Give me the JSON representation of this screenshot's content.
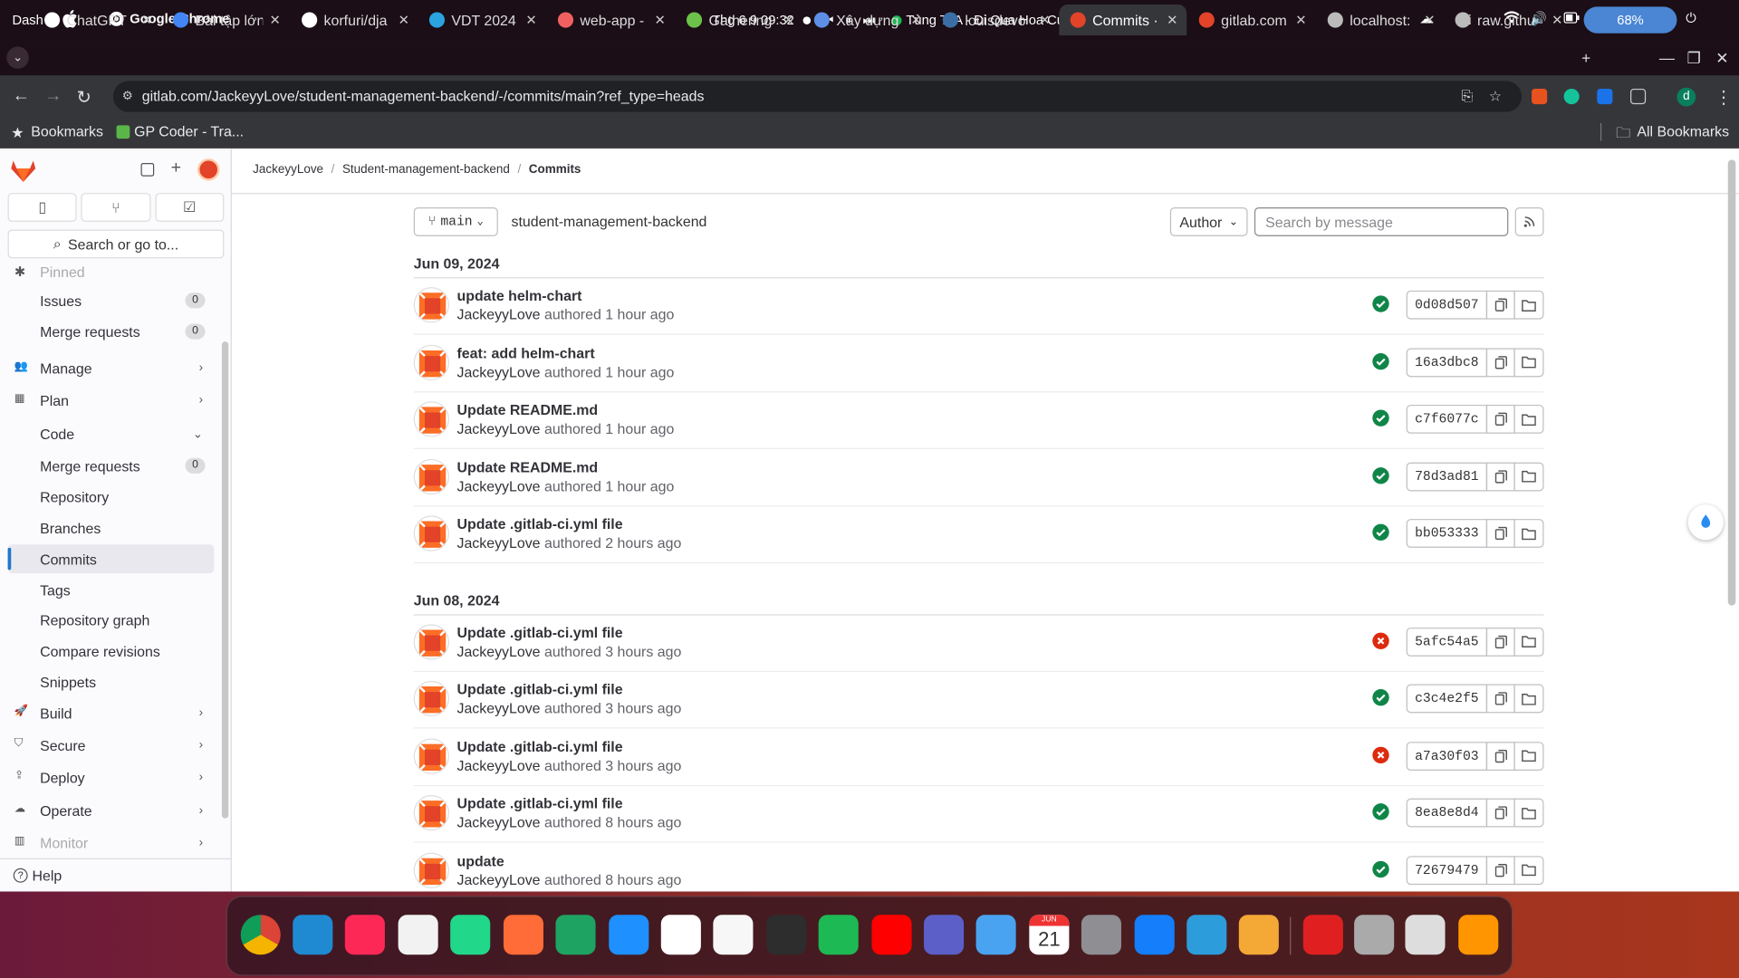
{
  "os": {
    "dash": "Dash",
    "app": "Google Chrome",
    "clock": "Thg 6 9  09:32",
    "song": "Tùng TeA - Đi Qua Hoa Cúc",
    "lang": "vi",
    "battery": "68%"
  },
  "tabs": [
    {
      "label": "ChatGPT",
      "color": "#ffffff"
    },
    {
      "label": "Bài tập lớn",
      "color": "#4285f4"
    },
    {
      "label": "korfuri/dja",
      "color": "#ffffff"
    },
    {
      "label": "VDT 2024",
      "color": "#2aa3e0"
    },
    {
      "label": "web-app -",
      "color": "#f06060"
    },
    {
      "label": "Gathering",
      "color": "#6cc24a"
    },
    {
      "label": "Xây dựng",
      "color": "#5e8ee6"
    },
    {
      "label": "louisdevo",
      "color": "#3a6ea5"
    },
    {
      "label": "Commits ·",
      "color": "#e24329"
    },
    {
      "label": "gitlab.com",
      "color": "#e24329"
    },
    {
      "label": "localhost:",
      "color": "#bbbbbb"
    },
    {
      "label": "raw.githu",
      "color": "#bbbbbb"
    }
  ],
  "browser": {
    "url": "gitlab.com/JackeyyLove/student-management-backend/-/commits/main?ref_type=heads",
    "bookmarks": "Bookmarks",
    "bookmark1": "GP Coder - Tra...",
    "all_bookmarks": "All Bookmarks",
    "profile": "d"
  },
  "sidebar": {
    "search": "Search or go to...",
    "pinned": "Pinned",
    "help": "Help",
    "items": [
      {
        "label": "Issues",
        "count": "0",
        "type": "sub"
      },
      {
        "label": "Merge requests",
        "count": "0",
        "type": "sub"
      },
      {
        "label": "Manage",
        "type": "top",
        "icon": "users-icon"
      },
      {
        "label": "Plan",
        "type": "top",
        "icon": "plan-icon"
      },
      {
        "label": "Code",
        "type": "top-open",
        "icon": "code-icon"
      },
      {
        "label": "Merge requests",
        "count": "0",
        "type": "sub"
      },
      {
        "label": "Repository",
        "type": "sub"
      },
      {
        "label": "Branches",
        "type": "sub"
      },
      {
        "label": "Commits",
        "type": "sub",
        "selected": true
      },
      {
        "label": "Tags",
        "type": "sub"
      },
      {
        "label": "Repository graph",
        "type": "sub"
      },
      {
        "label": "Compare revisions",
        "type": "sub"
      },
      {
        "label": "Snippets",
        "type": "sub"
      },
      {
        "label": "Build",
        "type": "top",
        "icon": "rocket-icon"
      },
      {
        "label": "Secure",
        "type": "top",
        "icon": "shield-icon"
      },
      {
        "label": "Deploy",
        "type": "top",
        "icon": "deploy-icon"
      },
      {
        "label": "Operate",
        "type": "top",
        "icon": "cloud-icon"
      },
      {
        "label": "Monitor",
        "type": "top",
        "icon": "monitor-icon"
      }
    ]
  },
  "breadcrumb": [
    "JackeyyLove",
    "Student-management-backend",
    "Commits"
  ],
  "toolbar": {
    "branch": "main",
    "project": "student-management-backend",
    "author": "Author",
    "search_placeholder": "Search by message"
  },
  "days": [
    {
      "date": "Jun 09, 2024",
      "commits": [
        {
          "title": "update helm-chart",
          "author": "JackeyyLove",
          "time": "authored 1 hour ago",
          "status": "success",
          "sha": "0d08d507"
        },
        {
          "title": "feat: add helm-chart",
          "author": "JackeyyLove",
          "time": "authored 1 hour ago",
          "status": "success",
          "sha": "16a3dbc8"
        },
        {
          "title": "Update README.md",
          "author": "JackeyyLove",
          "time": "authored 1 hour ago",
          "status": "success",
          "sha": "c7f6077c"
        },
        {
          "title": "Update README.md",
          "author": "JackeyyLove",
          "time": "authored 1 hour ago",
          "status": "success",
          "sha": "78d3ad81"
        },
        {
          "title": "Update .gitlab-ci.yml file",
          "author": "JackeyyLove",
          "time": "authored 2 hours ago",
          "status": "success",
          "sha": "bb053333"
        }
      ]
    },
    {
      "date": "Jun 08, 2024",
      "commits": [
        {
          "title": "Update .gitlab-ci.yml file",
          "author": "JackeyyLove",
          "time": "authored 3 hours ago",
          "status": "failed",
          "sha": "5afc54a5"
        },
        {
          "title": "Update .gitlab-ci.yml file",
          "author": "JackeyyLove",
          "time": "authored 3 hours ago",
          "status": "success",
          "sha": "c3c4e2f5"
        },
        {
          "title": "Update .gitlab-ci.yml file",
          "author": "JackeyyLove",
          "time": "authored 3 hours ago",
          "status": "failed",
          "sha": "a7a30f03"
        },
        {
          "title": "Update .gitlab-ci.yml file",
          "author": "JackeyyLove",
          "time": "authored 8 hours ago",
          "status": "success",
          "sha": "8ea8e8d4"
        },
        {
          "title": "update",
          "author": "JackeyyLove",
          "time": "authored 8 hours ago",
          "status": "success",
          "sha": "72679479"
        }
      ]
    }
  ],
  "dock": [
    {
      "name": "chrome-icon",
      "color": "#4285f4"
    },
    {
      "name": "vscode-icon",
      "color": "#1f8ad2"
    },
    {
      "name": "intellij-icon",
      "color": "#fe2857"
    },
    {
      "name": "apps-grid-icon",
      "color": "#f2f2f2"
    },
    {
      "name": "pycharm-icon",
      "color": "#21d789"
    },
    {
      "name": "postman-icon",
      "color": "#ff6c37"
    },
    {
      "name": "sheets-icon",
      "color": "#1ea362"
    },
    {
      "name": "app-store-icon",
      "color": "#1e90ff"
    },
    {
      "name": "notion-icon",
      "color": "#ffffff"
    },
    {
      "name": "notes-icon",
      "color": "#f7f7f7"
    },
    {
      "name": "terminal-icon",
      "color": "#2d2d2d"
    },
    {
      "name": "spotify-icon",
      "color": "#1db954"
    },
    {
      "name": "youtube-icon",
      "color": "#ff0000"
    },
    {
      "name": "teams-icon",
      "color": "#5b5fc7"
    },
    {
      "name": "finder-icon",
      "color": "#4aa3f0"
    },
    {
      "name": "calendar-icon",
      "color": "#ffffff"
    },
    {
      "name": "settings-icon",
      "color": "#8e8e93"
    },
    {
      "name": "xcode-icon",
      "color": "#147efb"
    },
    {
      "name": "box-icon",
      "color": "#2d9cdb"
    },
    {
      "name": "slides-icon",
      "color": "#f4a836"
    },
    {
      "name": "pdf-icon",
      "color": "#e02020"
    },
    {
      "name": "drive-icon",
      "color": "#aaaaaa"
    },
    {
      "name": "trash-icon",
      "color": "#dddddd"
    },
    {
      "name": "app-grid-icon",
      "color": "#ff9500"
    }
  ],
  "calendar": {
    "month": "JUN",
    "day": "21"
  }
}
